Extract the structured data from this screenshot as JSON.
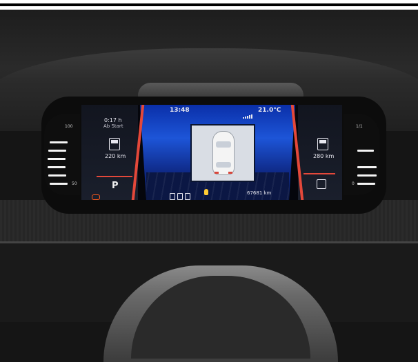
{
  "cluster": {
    "clock": "13:48",
    "outside_temp": "21.0°C",
    "trip": {
      "duration": "0:17 h",
      "label": "Ab Start"
    },
    "fuel_range": "220 km",
    "electric_range": "280 km",
    "gear": "P",
    "odometer": "67681 km",
    "left_gauge": {
      "top": "100",
      "bottom": "50"
    },
    "right_gauge": {
      "top": "1/1",
      "bottom": "0"
    },
    "icons": {
      "fuel": "fuel-pump-icon",
      "charge": "charge-plug-icon",
      "drive_mode": "drive-mode-icon",
      "vehicle": "car-top-view-icon",
      "signal": "signal-bars-icon",
      "coolant": "coolant-temp-icon",
      "engine_warning": "engine-warning-icon"
    },
    "accent_color": "#e4483a",
    "panel_color": "#1d55d8"
  }
}
